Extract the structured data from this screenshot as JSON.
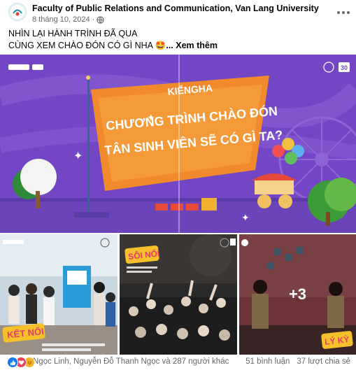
{
  "post": {
    "author": "Faculty of Public Relations and Communication, Van Lang University",
    "date": "8 tháng 10, 2024",
    "audience_icon": "globe-icon",
    "text_line1": "NHÌN LẠI HÀNH TRÌNH ĐÃ QUA",
    "text_line2": "CÙNG XEM CHÀO ĐÓN CÓ GÌ NHA",
    "emoji": "star-struck-emoji",
    "see_more": "... Xem thêm"
  },
  "hero": {
    "logo": "KIỂNGHA",
    "title_line1": "CHƯƠNG TRÌNH CHÀO ĐÓN",
    "title_line2": "TÂN SINH VIÊN SẼ CÓ GÌ TA?",
    "badge": "30",
    "bg_color": "#6d3fc0",
    "banner_color": "#f08a2c"
  },
  "tiles": [
    {
      "label": "KẾT NỐI",
      "caption": "",
      "bg_color": "#d2e0ea"
    },
    {
      "label": "SÔI NỔI",
      "caption": "",
      "bg_color": "#2a2a2a"
    },
    {
      "label": "LÝ KỲ",
      "overlay": "+3",
      "bg_color": "#5a3f3f"
    }
  ],
  "footer": {
    "reactors": "Ngọc Linh, Nguyễn Đỗ Thanh Ngọc và 287 người khác",
    "comments": "51 bình luận",
    "shares": "37 lượt chia sẻ",
    "reaction_colors": [
      "#1877f2",
      "#f33e58",
      "#f7b125"
    ]
  }
}
